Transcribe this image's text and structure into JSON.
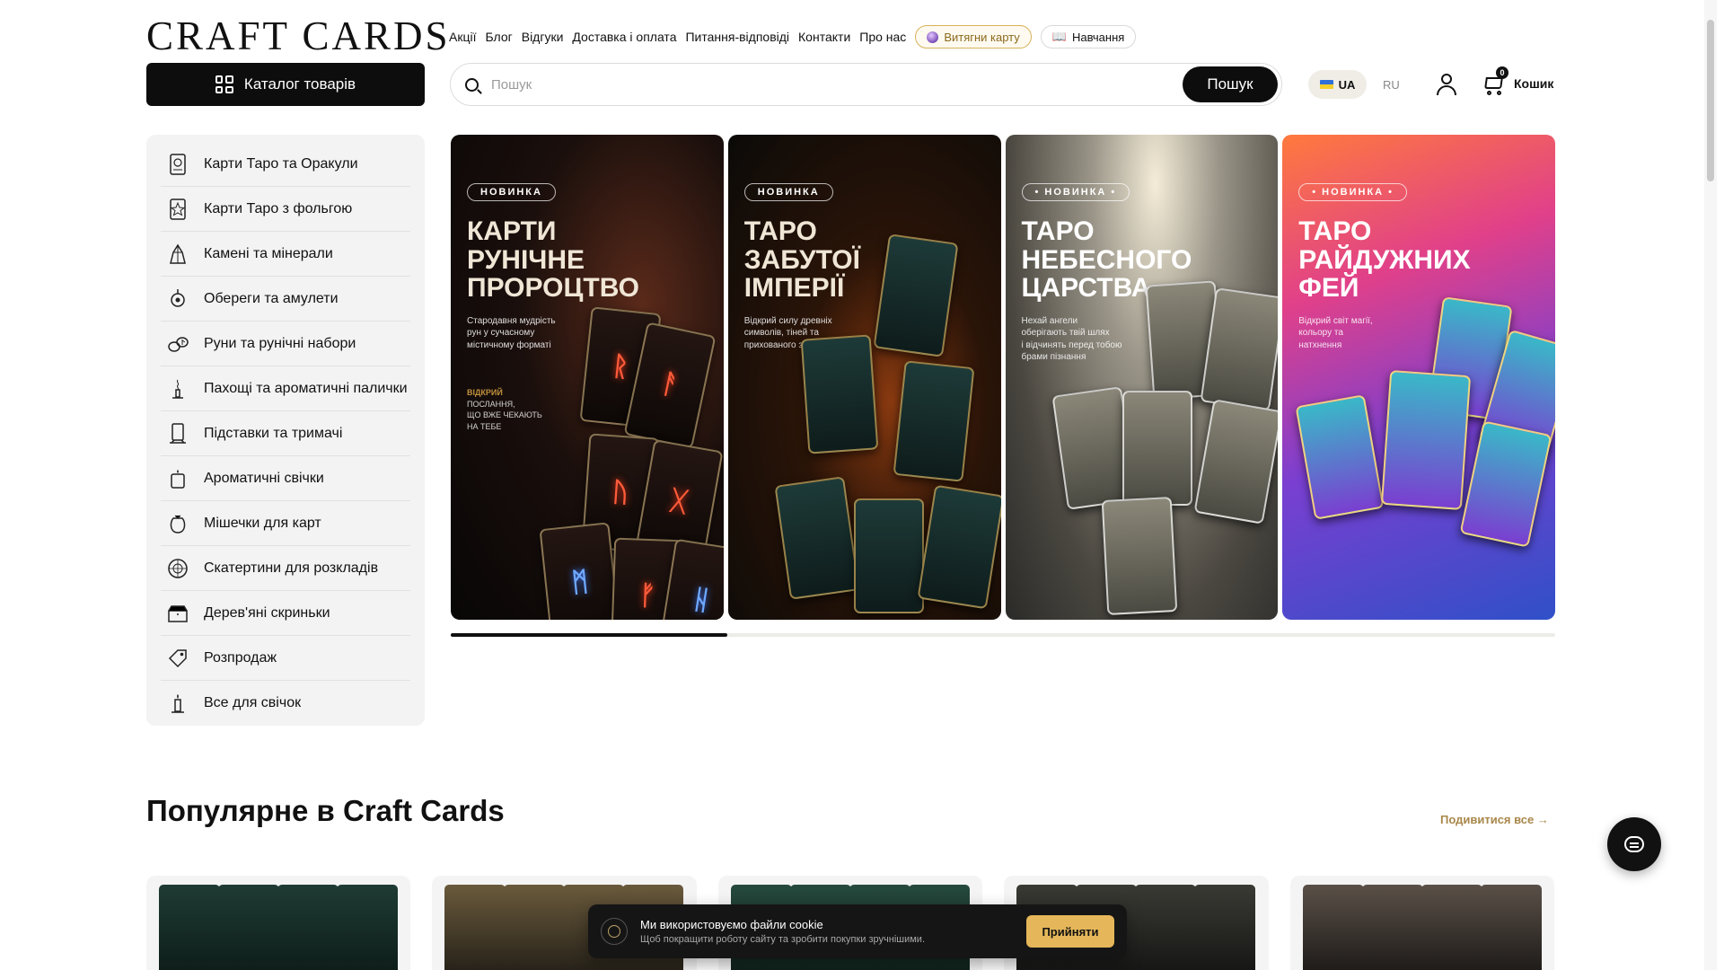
{
  "header": {
    "logo": "CRAFT CARDS",
    "nav": [
      "Акції",
      "Блог",
      "Відгуки",
      "Доставка і оплата",
      "Питання-відповіді",
      "Контакти",
      "Про нас"
    ],
    "draw_card": "Витягни карту",
    "learning": "Навчання",
    "catalog": "Каталог товарів",
    "search_placeholder": "Пошук",
    "search_button": "Пошук",
    "lang_ua": "UA",
    "lang_ru": "RU",
    "cart_label": "Кошик",
    "cart_count": "0"
  },
  "sidebar": {
    "items": [
      {
        "label": "Карти Таро та Оракули",
        "icon": "tarot-card-icon"
      },
      {
        "label": "Карти Таро з фольгою",
        "icon": "foil-card-icon"
      },
      {
        "label": "Камені та мінерали",
        "icon": "crystal-icon"
      },
      {
        "label": "Обереги та амулети",
        "icon": "amulet-icon"
      },
      {
        "label": "Руни та рунічні набори",
        "icon": "runes-icon"
      },
      {
        "label": "Пахощі та ароматичні палички",
        "icon": "incense-icon"
      },
      {
        "label": "Підставки та тримачі",
        "icon": "stand-icon"
      },
      {
        "label": "Ароматичні свічки",
        "icon": "candle-jar-icon"
      },
      {
        "label": "Мішечки для карт",
        "icon": "pouch-icon"
      },
      {
        "label": "Скатертини для розкладів",
        "icon": "tablecloth-icon"
      },
      {
        "label": "Дерев'яні скриньки",
        "icon": "wooden-box-icon"
      },
      {
        "label": "Розпродаж",
        "icon": "sale-icon"
      },
      {
        "label": "Все для свічок",
        "icon": "candle-icon"
      }
    ]
  },
  "banners": [
    {
      "badge": "НОВИНКА",
      "title": "КАРТИ\nРУНІЧНЕ\nПРОРОЦТВО",
      "sub": "Стародавня мудрість\nрун у сучасному\nмістичному форматі",
      "extra_head": "ВІДКРИЙ",
      "extra": "ПОСЛАННЯ,\nЩО ВЖЕ ЧЕКАЮТЬ\nНА ТЕБЕ"
    },
    {
      "badge": "НОВИНКА",
      "title": "ТАРО\nЗАБУТОЇ\nІМПЕРІЇ",
      "sub": "Відкрий силу древніх\nсимволів, тіней та\nприхованого знання"
    },
    {
      "badge": "• НОВИНКА •",
      "title": "ТАРО\nНЕБЕСНОГО\nЦАРСТВА",
      "sub": "Нехай ангели\nоберігають твій шлях\nі відчинять перед тобою\nбрами пізнання"
    },
    {
      "badge": "• НОВИНКА •",
      "title": "ТАРО\nРАЙДУЖНИХ\nФЕЙ",
      "sub": "Відкрий світ магії,\nкольору та\nнатхнення"
    }
  ],
  "carousel_progress": 0.25,
  "popular": {
    "title": "Популярне в Craft Cards",
    "see_all": "Подивитися все"
  },
  "cookie": {
    "title": "Ми використовуємо файли cookie",
    "subtitle": "Щоб покращити роботу сайту та зробити покупки зручнішими.",
    "accept": "Прийняти"
  },
  "colors": {
    "accent_gold": "#e5b75a",
    "see_all_gold": "#a9874a",
    "dark": "#0d0d0d"
  }
}
